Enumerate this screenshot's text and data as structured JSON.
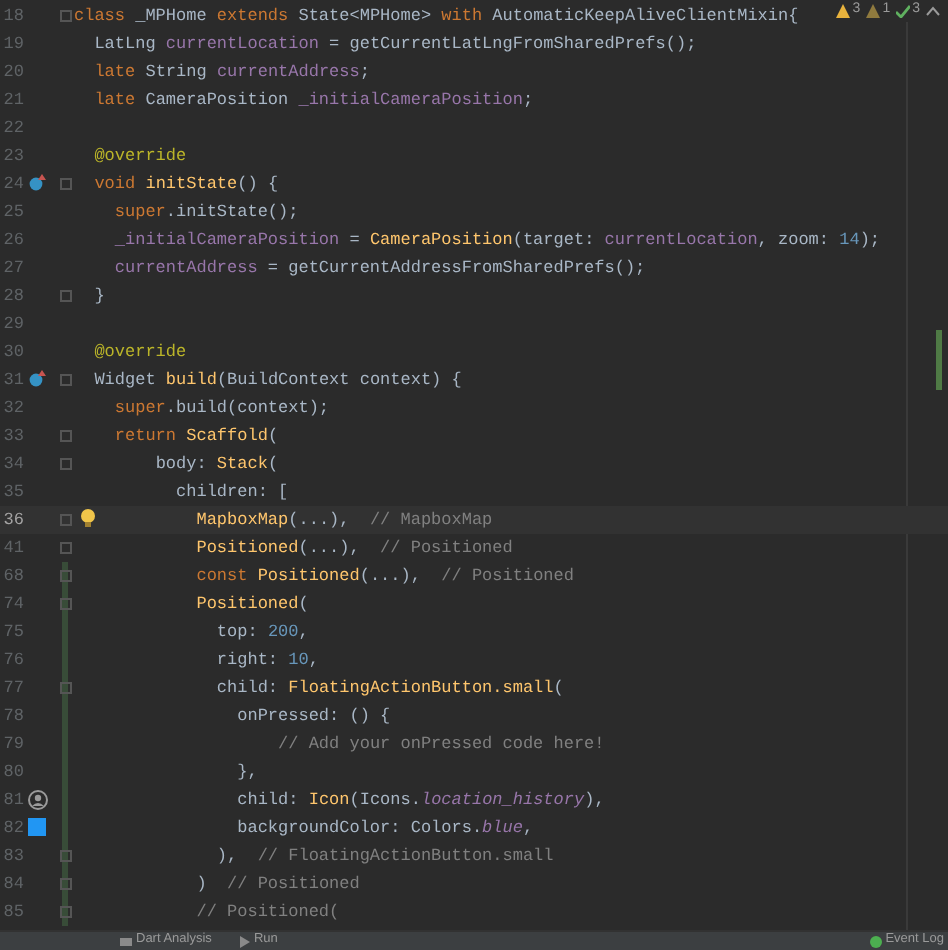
{
  "inspections": [
    {
      "kind": "warning",
      "count": "3"
    },
    {
      "kind": "weak",
      "count": "1"
    },
    {
      "kind": "ok",
      "count": "3"
    }
  ],
  "lines": [
    {
      "number": "18",
      "fold": true,
      "selected": false,
      "changed": false,
      "tokens": [
        {
          "kind": "keyword",
          "text": "class "
        },
        {
          "kind": "plain",
          "text": "_MPHome "
        },
        {
          "kind": "keyword",
          "text": "extends "
        },
        {
          "kind": "plain",
          "text": "State<MPHome> "
        },
        {
          "kind": "keyword",
          "text": "with "
        },
        {
          "kind": "plain",
          "text": "AutomaticKeepAliveClientMixin{"
        }
      ]
    },
    {
      "number": "19",
      "fold": false,
      "selected": false,
      "changed": false,
      "tokens": [
        {
          "kind": "plain",
          "text": "  LatLng "
        },
        {
          "kind": "field",
          "text": "currentLocation"
        },
        {
          "kind": "plain",
          "text": " = getCurrentLatLngFromSharedPrefs();"
        }
      ]
    },
    {
      "number": "20",
      "fold": false,
      "selected": false,
      "changed": false,
      "tokens": [
        {
          "kind": "keyword",
          "text": "  late "
        },
        {
          "kind": "plain",
          "text": "String "
        },
        {
          "kind": "field",
          "text": "currentAddress"
        },
        {
          "kind": "plain",
          "text": ";"
        }
      ]
    },
    {
      "number": "21",
      "fold": false,
      "selected": false,
      "changed": false,
      "tokens": [
        {
          "kind": "keyword",
          "text": "  late "
        },
        {
          "kind": "plain",
          "text": "CameraPosition "
        },
        {
          "kind": "field",
          "text": "_initialCameraPosition"
        },
        {
          "kind": "plain",
          "text": ";"
        }
      ]
    },
    {
      "number": "22",
      "fold": false,
      "selected": false,
      "changed": false
    },
    {
      "number": "23",
      "fold": false,
      "selected": false,
      "changed": false,
      "tokens": [
        {
          "kind": "annotation",
          "text": "  @override"
        }
      ]
    },
    {
      "number": "24",
      "fold": true,
      "selected": false,
      "changed": false,
      "marker": {
        "kind": "override"
      },
      "tokens": [
        {
          "kind": "keyword",
          "text": "  void "
        },
        {
          "kind": "function",
          "text": "initState"
        },
        {
          "kind": "plain",
          "text": "() {"
        }
      ]
    },
    {
      "number": "25",
      "fold": false,
      "selected": false,
      "changed": false,
      "tokens": [
        {
          "kind": "keyword",
          "text": "    super"
        },
        {
          "kind": "plain",
          "text": ".initState();"
        }
      ]
    },
    {
      "number": "26",
      "fold": false,
      "selected": false,
      "changed": false,
      "tokens": [
        {
          "kind": "field",
          "text": "    _initialCameraPosition"
        },
        {
          "kind": "plain",
          "text": " = "
        },
        {
          "kind": "function",
          "text": "CameraPosition"
        },
        {
          "kind": "plain",
          "text": "(target: "
        },
        {
          "kind": "field",
          "text": "currentLocation"
        },
        {
          "kind": "plain",
          "text": ", zoom: "
        },
        {
          "kind": "number",
          "text": "14"
        },
        {
          "kind": "plain",
          "text": ");"
        }
      ]
    },
    {
      "number": "27",
      "fold": false,
      "selected": false,
      "changed": false,
      "tokens": [
        {
          "kind": "field",
          "text": "    currentAddress"
        },
        {
          "kind": "plain",
          "text": " = getCurrentAddressFromSharedPrefs();"
        }
      ]
    },
    {
      "number": "28",
      "fold": true,
      "selected": false,
      "changed": false,
      "tokens": [
        {
          "kind": "plain",
          "text": "  }"
        }
      ]
    },
    {
      "number": "29",
      "fold": false,
      "selected": false,
      "changed": false
    },
    {
      "number": "30",
      "fold": false,
      "selected": false,
      "changed": false,
      "tokens": [
        {
          "kind": "annotation",
          "text": "  @override"
        }
      ]
    },
    {
      "number": "31",
      "fold": true,
      "selected": false,
      "changed": false,
      "marker": {
        "kind": "override"
      },
      "tokens": [
        {
          "kind": "plain",
          "text": "  Widget "
        },
        {
          "kind": "function",
          "text": "build"
        },
        {
          "kind": "plain",
          "text": "(BuildContext context) {"
        }
      ]
    },
    {
      "number": "32",
      "fold": false,
      "selected": false,
      "changed": false,
      "tokens": [
        {
          "kind": "keyword",
          "text": "    super"
        },
        {
          "kind": "plain",
          "text": ".build(context);"
        }
      ]
    },
    {
      "number": "33",
      "fold": true,
      "selected": false,
      "changed": false,
      "tokens": [
        {
          "kind": "keyword",
          "text": "    return "
        },
        {
          "kind": "function",
          "text": "Scaffold"
        },
        {
          "kind": "plain",
          "text": "("
        }
      ]
    },
    {
      "number": "34",
      "fold": true,
      "selected": false,
      "changed": false,
      "tokens": [
        {
          "kind": "plain",
          "text": "        body: "
        },
        {
          "kind": "function",
          "text": "Stack"
        },
        {
          "kind": "plain",
          "text": "("
        }
      ]
    },
    {
      "number": "35",
      "fold": false,
      "selected": false,
      "changed": false,
      "tokens": [
        {
          "kind": "plain",
          "text": "          children: ["
        }
      ]
    },
    {
      "number": "36",
      "fold": true,
      "selected": true,
      "changed": false,
      "marker": {
        "kind": "bulb"
      },
      "tokens": [
        {
          "kind": "function",
          "text": "            MapboxMap"
        },
        {
          "kind": "plain",
          "text": "(...),  "
        },
        {
          "kind": "comment",
          "text": "// MapboxMap"
        }
      ]
    },
    {
      "number": "41",
      "fold": true,
      "selected": false,
      "changed": false,
      "tokens": [
        {
          "kind": "function",
          "text": "            Positioned"
        },
        {
          "kind": "plain",
          "text": "(...),  "
        },
        {
          "kind": "comment",
          "text": "// Positioned"
        }
      ]
    },
    {
      "number": "68",
      "fold": true,
      "selected": false,
      "changed": true,
      "tokens": [
        {
          "kind": "keyword",
          "text": "            const "
        },
        {
          "kind": "function",
          "text": "Positioned"
        },
        {
          "kind": "plain",
          "text": "(...),  "
        },
        {
          "kind": "comment",
          "text": "// Positioned"
        }
      ]
    },
    {
      "number": "74",
      "fold": true,
      "selected": false,
      "changed": true,
      "tokens": [
        {
          "kind": "function",
          "text": "            Positioned"
        },
        {
          "kind": "plain",
          "text": "("
        }
      ]
    },
    {
      "number": "75",
      "fold": false,
      "selected": false,
      "changed": true,
      "tokens": [
        {
          "kind": "plain",
          "text": "              top: "
        },
        {
          "kind": "number",
          "text": "200"
        },
        {
          "kind": "plain",
          "text": ","
        }
      ]
    },
    {
      "number": "76",
      "fold": false,
      "selected": false,
      "changed": true,
      "tokens": [
        {
          "kind": "plain",
          "text": "              right: "
        },
        {
          "kind": "number",
          "text": "10"
        },
        {
          "kind": "plain",
          "text": ","
        }
      ]
    },
    {
      "number": "77",
      "fold": true,
      "selected": false,
      "changed": true,
      "tokens": [
        {
          "kind": "plain",
          "text": "              child: "
        },
        {
          "kind": "function",
          "text": "FloatingActionButton.small"
        },
        {
          "kind": "plain",
          "text": "("
        }
      ]
    },
    {
      "number": "78",
      "fold": false,
      "selected": false,
      "changed": true,
      "tokens": [
        {
          "kind": "plain",
          "text": "                onPressed: () {"
        }
      ]
    },
    {
      "number": "79",
      "fold": false,
      "selected": false,
      "changed": true,
      "tokens": [
        {
          "kind": "comment",
          "text": "                    // Add your onPressed code here!"
        }
      ]
    },
    {
      "number": "80",
      "fold": false,
      "selected": false,
      "changed": true,
      "tokens": [
        {
          "kind": "plain",
          "text": "                },"
        }
      ]
    },
    {
      "number": "81",
      "fold": false,
      "selected": false,
      "changed": true,
      "marker": {
        "kind": "person"
      },
      "tokens": [
        {
          "kind": "plain",
          "text": "                child: "
        },
        {
          "kind": "function",
          "text": "Icon"
        },
        {
          "kind": "plain",
          "text": "(Icons."
        },
        {
          "kind": "italic",
          "text": "location_history"
        },
        {
          "kind": "plain",
          "text": "),"
        }
      ]
    },
    {
      "number": "82",
      "fold": false,
      "selected": false,
      "changed": true,
      "marker": {
        "kind": "swatch",
        "color": "#2196f3"
      },
      "tokens": [
        {
          "kind": "plain",
          "text": "                backgroundColor: Colors."
        },
        {
          "kind": "italic",
          "text": "blue"
        },
        {
          "kind": "plain",
          "text": ","
        }
      ]
    },
    {
      "number": "83",
      "fold": true,
      "selected": false,
      "changed": true,
      "tokens": [
        {
          "kind": "plain",
          "text": "              ),  "
        },
        {
          "kind": "comment",
          "text": "// FloatingActionButton.small"
        }
      ]
    },
    {
      "number": "84",
      "fold": true,
      "selected": false,
      "changed": true,
      "tokens": [
        {
          "kind": "plain",
          "text": "            )  "
        },
        {
          "kind": "comment",
          "text": "// Positioned"
        }
      ]
    },
    {
      "number": "85",
      "fold": true,
      "selected": false,
      "changed": true,
      "tokens": [
        {
          "kind": "comment",
          "text": "            // Positioned("
        }
      ]
    }
  ],
  "status_bar": [
    {
      "kind": "analysis",
      "label": "Dart Analysis"
    },
    {
      "kind": "run",
      "label": "Run"
    },
    {
      "kind": "log",
      "label": "Event Log"
    }
  ]
}
